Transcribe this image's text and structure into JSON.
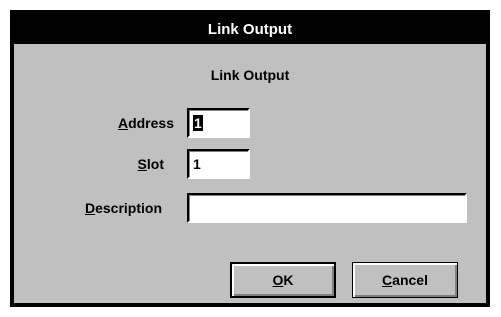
{
  "window": {
    "title": "Link Output"
  },
  "dialog": {
    "heading": "Link Output",
    "address": {
      "mnemonic": "A",
      "rest": "ddress",
      "value": "1"
    },
    "slot": {
      "mnemonic": "S",
      "rest": "lot",
      "value": "1"
    },
    "description": {
      "mnemonic": "D",
      "rest": "escription",
      "value": ""
    }
  },
  "buttons": {
    "ok": {
      "mnemonic": "O",
      "rest": "K"
    },
    "cancel": {
      "mnemonic": "C",
      "rest": "ancel"
    }
  },
  "colors": {
    "dialog_bg": "#c0c0c0",
    "titlebar_bg": "#000000",
    "titlebar_text": "#ffffff"
  }
}
